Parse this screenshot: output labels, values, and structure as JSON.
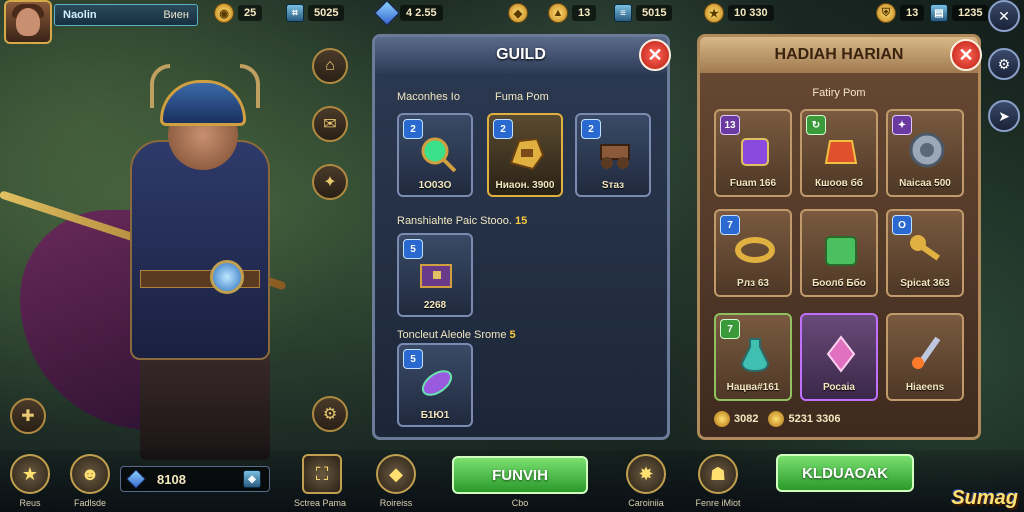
{
  "topbar": {
    "player_name": "Naolin",
    "player_sub": "Виен",
    "resources_left": [
      {
        "icon": "coin-icon",
        "value": "25"
      },
      {
        "icon": "ticket-icon",
        "value": "5025"
      }
    ],
    "resources_mid": [
      {
        "icon": "gem-icon",
        "value": "4 2.55"
      },
      {
        "icon": "token-icon",
        "value": ""
      },
      {
        "icon": "gold-pile-icon",
        "value": "13"
      },
      {
        "icon": "scroll-icon",
        "value": "5015"
      }
    ],
    "resources_right": [
      {
        "icon": "star-icon",
        "value": "10 330"
      },
      {
        "icon": "shield-icon",
        "value": "13"
      },
      {
        "icon": "book-icon",
        "value": "1235"
      }
    ]
  },
  "guild_panel": {
    "title": "GUILD",
    "close_label": "✕",
    "section1_left": "Мaconhes Io",
    "section1_right": "Fuma Pom",
    "section1_items": [
      {
        "badge": "2",
        "label": "1О0ЗО",
        "name": "emerald-staff-icon"
      },
      {
        "badge": "2",
        "label": "Ниаон. 3900",
        "name": "golden-gauntlet-icon"
      },
      {
        "badge": "2",
        "label": "Sтаз",
        "name": "siege-cart-icon"
      }
    ],
    "section2_title": "Ranshiahte Paic Stooo.",
    "section2_count": "15",
    "section2_items": [
      {
        "badge": "5",
        "label": "2268",
        "name": "treasure-chest-icon"
      }
    ],
    "section3_title": "Toncleut Aleole Srome",
    "section3_count": "5",
    "section3_items": [
      {
        "badge": "5",
        "label": "Б1Ю1",
        "name": "magic-leaf-icon"
      }
    ]
  },
  "daily_panel": {
    "title": "HADIAH HARIAN",
    "close_label": "✕",
    "subtitle": "Fatiry Pom",
    "items": [
      {
        "badge": "13",
        "label": "Fuam 166",
        "name": "purple-potion-icon",
        "style": "normal",
        "badge_color": "purple"
      },
      {
        "badge": "↻",
        "label": "Кшоов бб",
        "name": "red-chest-icon",
        "style": "normal",
        "badge_color": "green"
      },
      {
        "badge": "✦",
        "label": "Naicaa 500",
        "name": "silver-shield-icon",
        "style": "normal",
        "badge_color": "purple"
      },
      {
        "badge": "7",
        "label": "Рлз 63",
        "name": "golden-ring-icon",
        "style": "normal",
        "badge_color": "blue"
      },
      {
        "badge": "",
        "label": "Боолб Ббо",
        "name": "green-box-icon",
        "style": "normal",
        "badge_color": ""
      },
      {
        "badge": "О",
        "label": "Spicat 363",
        "name": "golden-key-icon",
        "style": "normal",
        "badge_color": "gold"
      },
      {
        "badge": "7",
        "label": "Нацва#161",
        "name": "potion-bottle-icon",
        "style": "green",
        "badge_color": "green"
      },
      {
        "badge": "",
        "label": "Росаіа",
        "name": "crystal-wand-icon",
        "style": "sel",
        "badge_color": ""
      },
      {
        "badge": "",
        "label": "Hiaeens",
        "name": "fire-sword-icon",
        "style": "normal",
        "badge_color": ""
      }
    ],
    "footer_res": [
      {
        "value": "3082"
      },
      {
        "value": "5231 3306"
      }
    ]
  },
  "bottom": {
    "left_icons": [
      {
        "label": "Reus",
        "name": "rank-icon"
      },
      {
        "label": "Fadlsde",
        "name": "hero-portrait-icon"
      }
    ],
    "counter_value": "8108",
    "counter_extra": "",
    "mid_icons": [
      {
        "label": "Sctrea Pama",
        "name": "map-icon"
      },
      {
        "label": "Roireiss",
        "name": "crystal-icon"
      }
    ],
    "guild_button": "FUNVIH",
    "guild_button_sub": "Cbo",
    "guild_right_icon_label": "Caroiniia",
    "daily_left_label": "Fenre iMiot",
    "daily_button": "KLDUAOAK",
    "logo": "Sumag"
  },
  "colors": {
    "guild_border": "#6a7a98",
    "daily_border": "#b08a5a",
    "button_green": "#2a9a2a",
    "close_red": "#b81a10"
  }
}
